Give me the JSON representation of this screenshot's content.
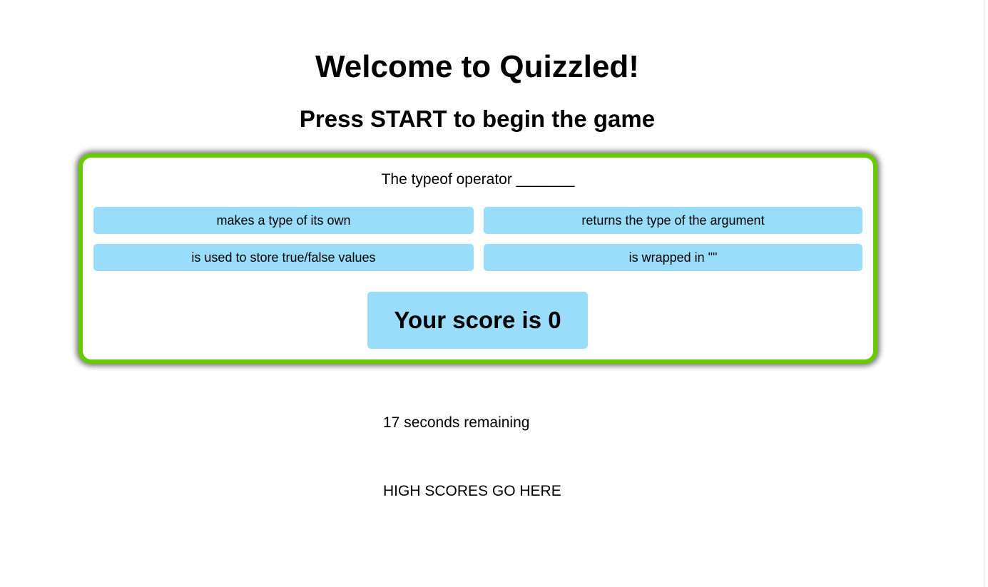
{
  "header": {
    "title": "Welcome to Quizzled!",
    "subtitle": "Press START to begin the game"
  },
  "quiz": {
    "question": "The typeof operator _______",
    "answers": [
      "makes a type of its own",
      "returns the type of the argument",
      "is used to store true/false values",
      "is wrapped in \"\""
    ],
    "score_text": "Your score is 0"
  },
  "status": {
    "timer_text": "17 seconds remaining",
    "high_scores_text": "HIGH SCORES GO HERE"
  },
  "colors": {
    "card_border": "#66cc00",
    "button_background": "#99ddfa",
    "page_background": "#ffffff"
  }
}
